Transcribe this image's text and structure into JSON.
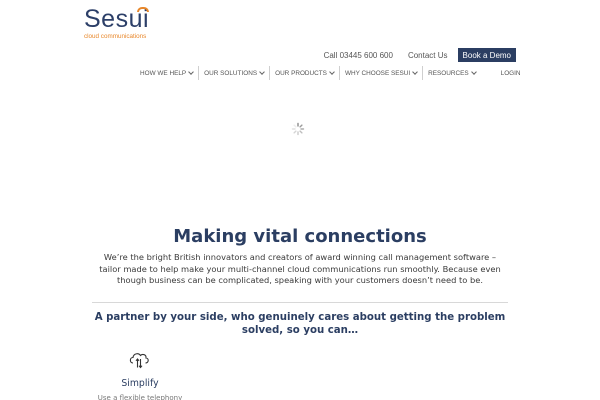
{
  "brand": {
    "wordmark": "Sesui",
    "tagline": "cloud communications",
    "accent_color": "#e8872a",
    "primary_color": "#2b3e62"
  },
  "topbar": {
    "phone": "Call 03445 600 600",
    "contact": "Contact Us",
    "demo": "Book a Demo"
  },
  "nav": {
    "items": [
      {
        "label": "HOW WE HELP"
      },
      {
        "label": "OUR SOLUTIONS"
      },
      {
        "label": "OUR PRODUCTS"
      },
      {
        "label": "WHY CHOOSE SESUI"
      },
      {
        "label": "RESOURCES"
      }
    ],
    "login": "LOGIN"
  },
  "hero": {
    "title": "Making vital connections",
    "body": "We’re the bright British innovators and creators of award winning call management software – tailor made to help make your multi-channel cloud communications run smoothly. Because even though business can be complicated, speaking with your customers doesn’t need to be."
  },
  "partner": {
    "heading": "A partner by your side, who genuinely cares about getting the problem solved, so you can…"
  },
  "features": [
    {
      "icon": "cloud-icon",
      "label": "Simplify",
      "desc": "Use a flexible telephony"
    }
  ]
}
